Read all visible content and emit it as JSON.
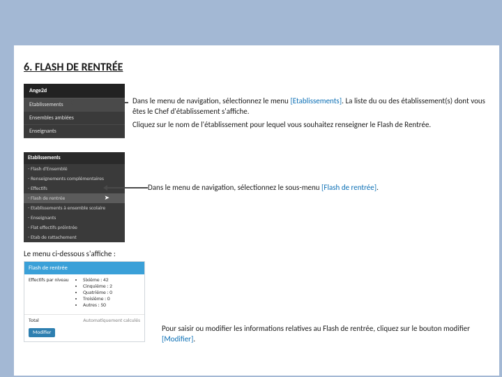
{
  "section_title": "6. FLASH DE RENTRÉE",
  "nav1": {
    "brand": "Ange2d",
    "items": [
      "Etablissements",
      "Ensembles ambiées",
      "Enseignants"
    ]
  },
  "para1_pre": "Dans le menu de navigation, sélectionnez le menu ",
  "para1_link": "[Etablissements]",
  "para1_post": ". La liste du ou des établissement(s) dont vous êtes le Chef d'établissement s'affiche.",
  "para2": "Cliquez sur le nom de l'établissement pour lequel vous souhaitez renseigner le Flash de Rentrée.",
  "nav2": {
    "header": "Etablissements",
    "items": [
      "- Flash d'Ensemblé",
      "- Renseignements complémentaires",
      "- Effectifs",
      "- Flash de rentrée",
      "- Etablissements à ensemble scolaire",
      "- Enseignants",
      "- Flat effectifs préintrée",
      "- Etab de rattachement"
    ]
  },
  "para3_pre": "Dans le menu de navigation, sélectionnez le sous-menu ",
  "para3_link": "[Flash de rentrée]",
  "para3_post": ".",
  "row3_label": "Le menu ci-dessous s'affiche :",
  "panel": {
    "title": "Flash de rentrée",
    "col1": "Effectifs par niveau",
    "bullets": [
      "Sixième : 42",
      "Cinquième : 2",
      "Quatrième : 0",
      "Troisième : 0",
      "Autres : 50"
    ],
    "footer_label": "Total",
    "footer_note": "Automatiquement calculés",
    "button": "Modifier"
  },
  "para4_pre": "Pour saisir ou modifier les informations relatives au Flash de rentrée, cliquez sur le bouton modifier ",
  "para4_link": "[Modifier]",
  "para4_post": "."
}
